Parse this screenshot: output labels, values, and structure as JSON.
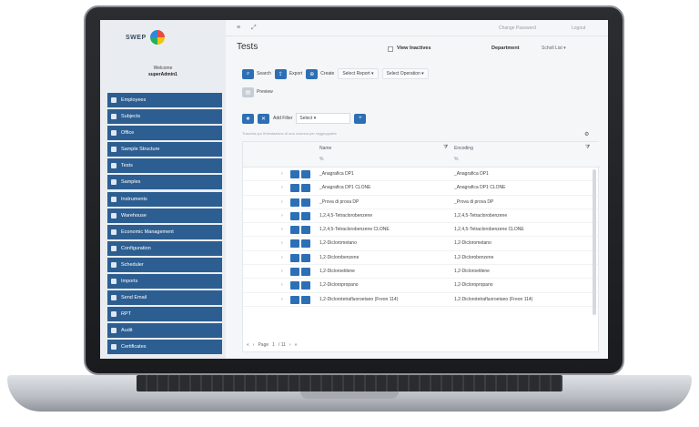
{
  "app": {
    "brand": "SWEP",
    "welcome": "Welcome",
    "user": "superAdmin1"
  },
  "sidebar": {
    "items": [
      {
        "label": "Employees"
      },
      {
        "label": "Subjects"
      },
      {
        "label": "Office"
      },
      {
        "label": "Sample Structure"
      },
      {
        "label": "Tests"
      },
      {
        "label": "Samples"
      },
      {
        "label": "Instruments"
      },
      {
        "label": "Warehouse"
      },
      {
        "label": "Economic Management"
      },
      {
        "label": "Configuration"
      },
      {
        "label": "Scheduler"
      },
      {
        "label": "Imports"
      },
      {
        "label": "Send Email"
      },
      {
        "label": "RPT"
      },
      {
        "label": "Audit"
      },
      {
        "label": "Certificates"
      }
    ]
  },
  "topbar": {
    "change_password": "Change Password",
    "logout": "Logout"
  },
  "page": {
    "title": "Tests",
    "view_inactives": "View Inactives",
    "department_label": "Department",
    "department_value": "Scholl List"
  },
  "toolbar": {
    "search": "Search",
    "export": "Export",
    "create": "Create",
    "select_report": "Select Report ▾",
    "select_operation": "Select Operation ▾",
    "preview": "Preview"
  },
  "filter": {
    "add_filter": "Add Filter",
    "select": "Select",
    "hint": "Trascina qui l'intestazione di una colonna per raggrupparla"
  },
  "grid": {
    "columns": [
      {
        "label": "Name"
      },
      {
        "label": "Encoding"
      }
    ],
    "rows": [
      {
        "name": "_Anagrafica DP1",
        "encoding": "_Anagrafica DP1"
      },
      {
        "name": "_Anagrafica DP1 CLONE",
        "encoding": "_Anagrafica DP1 CLONE"
      },
      {
        "name": "_Prova di prova DP",
        "encoding": "_Prova di prova DP"
      },
      {
        "name": "1,2,4,5-Tetraclorobenzene",
        "encoding": "1,2,4,5-Tetraclorobenzene"
      },
      {
        "name": "1,2,4,5-Tetraclorobenzene CLONE",
        "encoding": "1,2,4,5-Tetraclorobenzene CLONE"
      },
      {
        "name": "1,2-Diclorometano",
        "encoding": "1,2-Diclorometano"
      },
      {
        "name": "1,2-Diclorobenzene",
        "encoding": "1,2-Diclorobenzene"
      },
      {
        "name": "1,2-Dicloroetilene",
        "encoding": "1,2-Dicloroetilene"
      },
      {
        "name": "1,2-Dicloropropano",
        "encoding": "1,2-Dicloropropano"
      },
      {
        "name": "1,2-Diclorotetrafluoroetano (Freon 114)",
        "encoding": "1,2-Diclorotetrafluoroetano (Freon 114)"
      }
    ],
    "pager": {
      "first": "«",
      "prev": "‹",
      "page_label": "Page",
      "page_value": "1",
      "of": "/ 11",
      "next": "›",
      "last": "»"
    }
  },
  "icons": {
    "search": "magnifier-icon",
    "export": "export-icon",
    "create": "create-icon",
    "gear": "gear-icon",
    "menu": "hamburger-icon",
    "expand": "expand-icon"
  }
}
